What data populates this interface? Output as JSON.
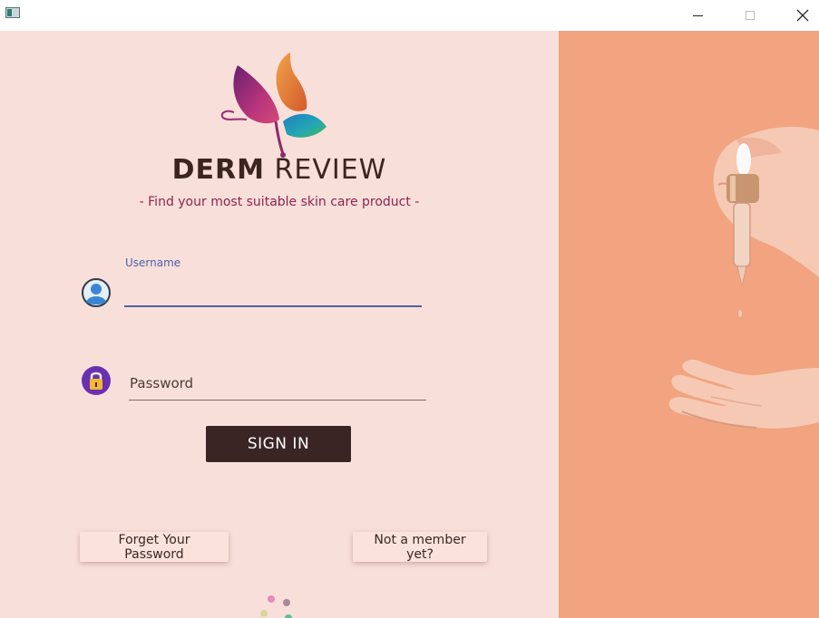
{
  "window": {
    "controls": [
      "minimize-icon",
      "maximize-icon",
      "close-icon"
    ]
  },
  "branding": {
    "name_bold": "DERM",
    "name_regular": "REVIEW",
    "tagline": "-  Find your most suitable skin care product  -",
    "logo_icon": "butterfly-icon"
  },
  "login": {
    "username_label": "Username",
    "username_value": "",
    "password_placeholder": "Password",
    "password_value": "",
    "signin_label": "SIGN IN",
    "forgot_label": "Forget Your Password",
    "member_label": "Not a member yet?"
  },
  "icons": {
    "user": "user-icon",
    "lock": "lock-icon"
  },
  "colors": {
    "left_bg": "#f9dfd9",
    "right_bg": "#f1a47f",
    "button_bg": "#3a2424",
    "accent_blue": "#4b64a8",
    "tagline": "#8b2450"
  }
}
